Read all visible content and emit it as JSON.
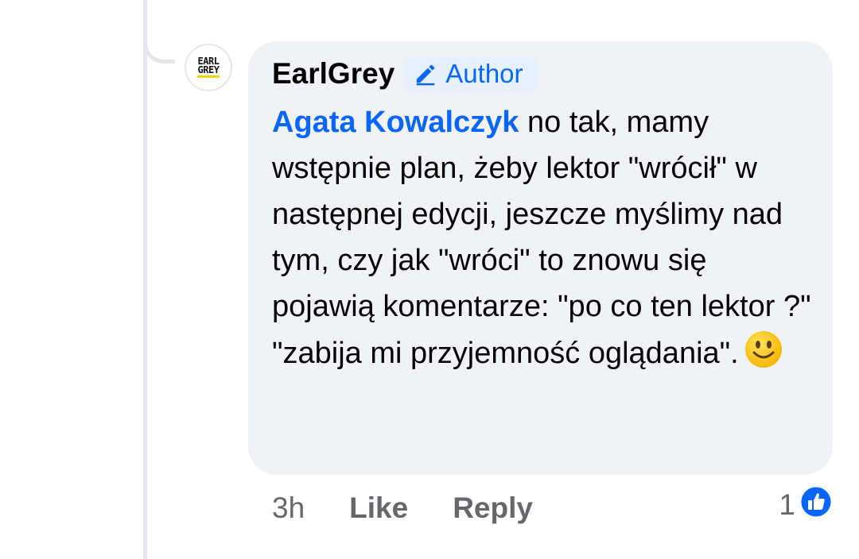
{
  "comment": {
    "author": "EarlGrey",
    "author_badge": "Author",
    "avatar_logo_line1": "EARL",
    "avatar_logo_line2": "GREY",
    "mention": "Agata Kowalczyk",
    "text": " no tak, mamy wstępnie plan, żeby lektor \"wrócił\" w następnej edycji, jeszcze myślimy nad tym, czy jak \"wróci\" to znowu się pojawią komentarze: \"po co ten lektor ?\" \"zabija mi przyjemność oglądania\".",
    "emoji": "smiling-face-emoji"
  },
  "actions": {
    "time": "3h",
    "like_label": "Like",
    "reply_label": "Reply"
  },
  "reactions": {
    "count": "1",
    "icon": "thumbs-up-icon"
  },
  "colors": {
    "accent": "#0866ff",
    "bubble": "#f0f2f5",
    "secondary_text": "#65676b"
  }
}
